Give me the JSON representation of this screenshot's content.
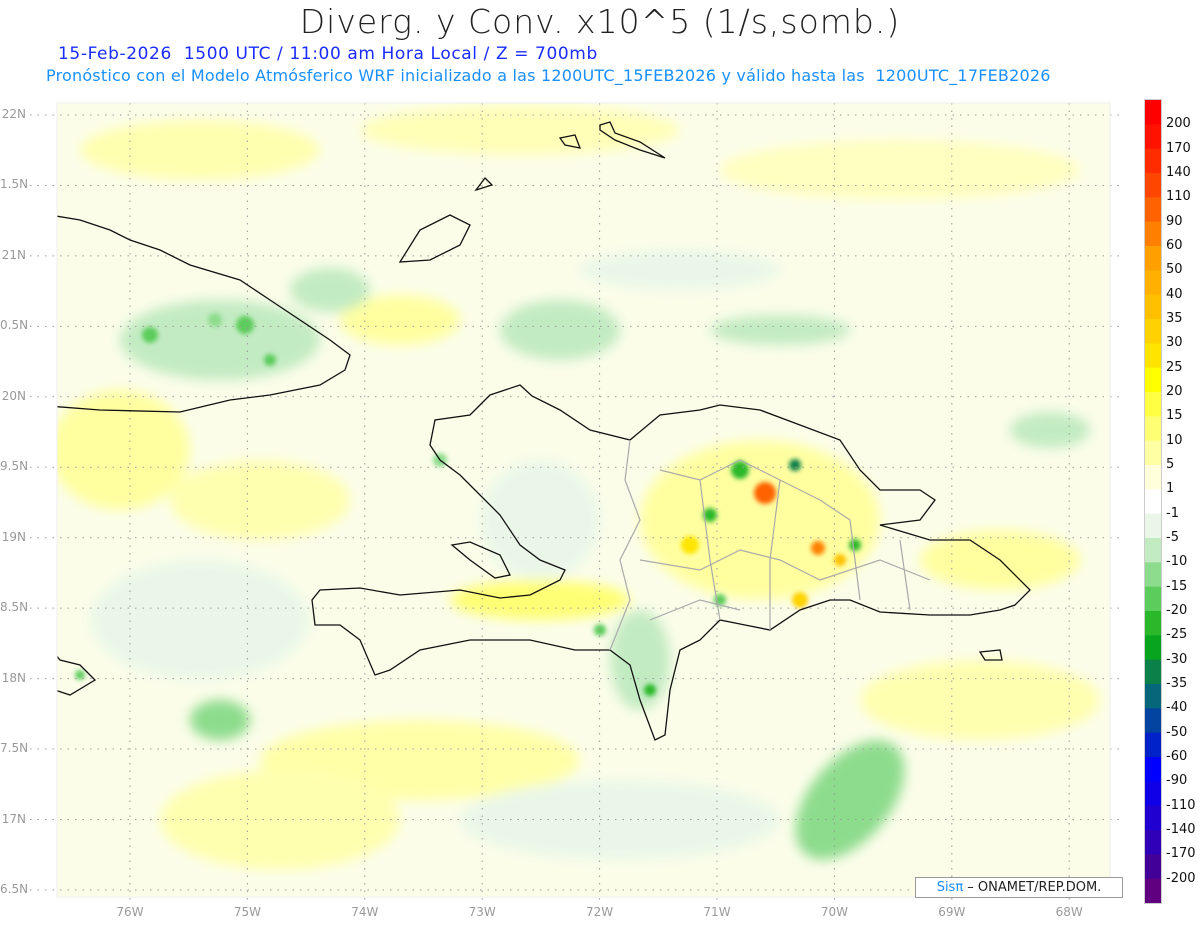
{
  "header": {
    "title": "Diverg. y Conv. x10^5 (1/s,somb.)",
    "subtitle_time": "15-Feb-2026  1500 UTC / 11:00 am Hora Local / Z = 700mb",
    "subtitle_model": "Pronóstico con el Modelo Atmósferico WRF inicializado a las 1200UTC_15FEB2026 y válido hasta las  1200UTC_17FEB2026"
  },
  "axes": {
    "lat_labels": [
      "22N",
      "1.5N",
      "21N",
      "0.5N",
      "20N",
      "9.5N",
      "19N",
      "8.5N",
      "18N",
      "7.5N",
      "17N",
      "6.5N"
    ],
    "lon_labels": [
      "76W",
      "75W",
      "74W",
      "73W",
      "72W",
      "71W",
      "70W",
      "69W",
      "68W"
    ]
  },
  "colorbar": {
    "labels": [
      "200",
      "170",
      "140",
      "110",
      "90",
      "60",
      "50",
      "40",
      "35",
      "30",
      "25",
      "20",
      "15",
      "10",
      "5",
      "1",
      "-1",
      "-5",
      "-10",
      "-15",
      "-20",
      "-25",
      "-30",
      "-35",
      "-40",
      "-50",
      "-60",
      "-90",
      "-110",
      "-140",
      "-170",
      "-200"
    ],
    "colors": [
      "#ff0000",
      "#ff1200",
      "#ff2c00",
      "#ff4600",
      "#ff6200",
      "#ff8000",
      "#ffa000",
      "#ffb000",
      "#ffc000",
      "#ffd200",
      "#ffe400",
      "#ffff00",
      "#ffff44",
      "#ffff74",
      "#ffffa4",
      "#ffffdc",
      "#ffffff",
      "#eaf7e8",
      "#c2ebc2",
      "#8ddc8d",
      "#5ccc5c",
      "#2ab82a",
      "#07a51e",
      "#0b8048",
      "#07677a",
      "#0344a0",
      "#0022c8",
      "#0000ff",
      "#1000e8",
      "#2000d0",
      "#3000b8",
      "#420098",
      "#600080"
    ]
  },
  "credit": {
    "brand": "Sisπ",
    "text": " – ONAMET/REP.DOM."
  }
}
